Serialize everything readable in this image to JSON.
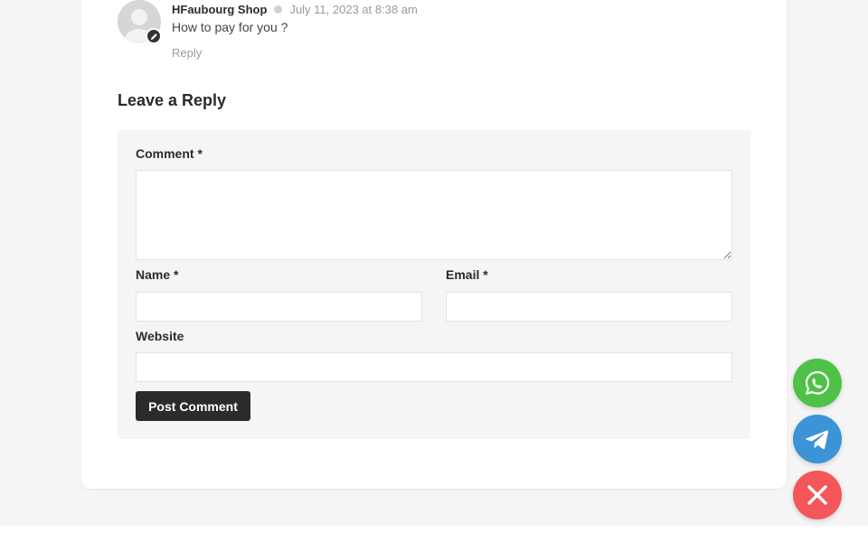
{
  "comment": {
    "author": "HFaubourg Shop",
    "date": "July 11, 2023 at 8:38 am",
    "text": "How to pay for you ?",
    "reply_label": "Reply"
  },
  "reply_form": {
    "title": "Leave a Reply",
    "comment_label": "Comment *",
    "name_label": "Name *",
    "email_label": "Email *",
    "website_label": "Website",
    "comment_value": "",
    "name_value": "",
    "email_value": "",
    "website_value": "",
    "submit_label": "Post Comment"
  },
  "floating_buttons": {
    "whatsapp": {
      "icon": "whatsapp-icon",
      "color": "#4dc247"
    },
    "telegram": {
      "icon": "telegram-icon",
      "color": "#3c93d6"
    },
    "close": {
      "icon": "close-icon",
      "color": "#f5565a"
    }
  },
  "colors": {
    "background": "#f5f5f5",
    "card": "#ffffff",
    "button": "#2b2b2b",
    "muted_text": "#9a9a9a"
  }
}
